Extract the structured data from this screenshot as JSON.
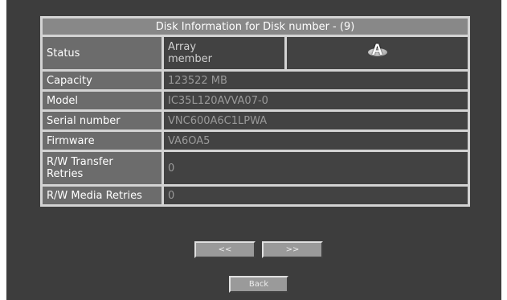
{
  "title": "Disk Information for Disk number - (9)",
  "rows": {
    "status": {
      "label": "Status",
      "value_line1": "Array",
      "value_line2": "member",
      "icon": "array-member-icon"
    },
    "capacity": {
      "label": "Capacity",
      "value": "123522 MB"
    },
    "model": {
      "label": "Model",
      "value": "IC35L120AVVA07-0"
    },
    "serial": {
      "label": "Serial number",
      "value": "VNC600A6C1LPWA"
    },
    "firmware": {
      "label": "Firmware",
      "value": "VA6OA5"
    },
    "rw_transfer": {
      "label_line1": "R/W Transfer",
      "label_line2": "Retries",
      "value": "0"
    },
    "rw_media": {
      "label": "R/W Media Retries",
      "value": "0"
    }
  },
  "icon_glyph": "A",
  "buttons": {
    "prev": "<<",
    "next": ">>",
    "back": "Back"
  },
  "colors": {
    "panel": "#3d3d3d",
    "title_bar": "#888888",
    "label_cell": "#6c6c6c",
    "value_cell": "#424242",
    "border": "#d3d3d3"
  }
}
